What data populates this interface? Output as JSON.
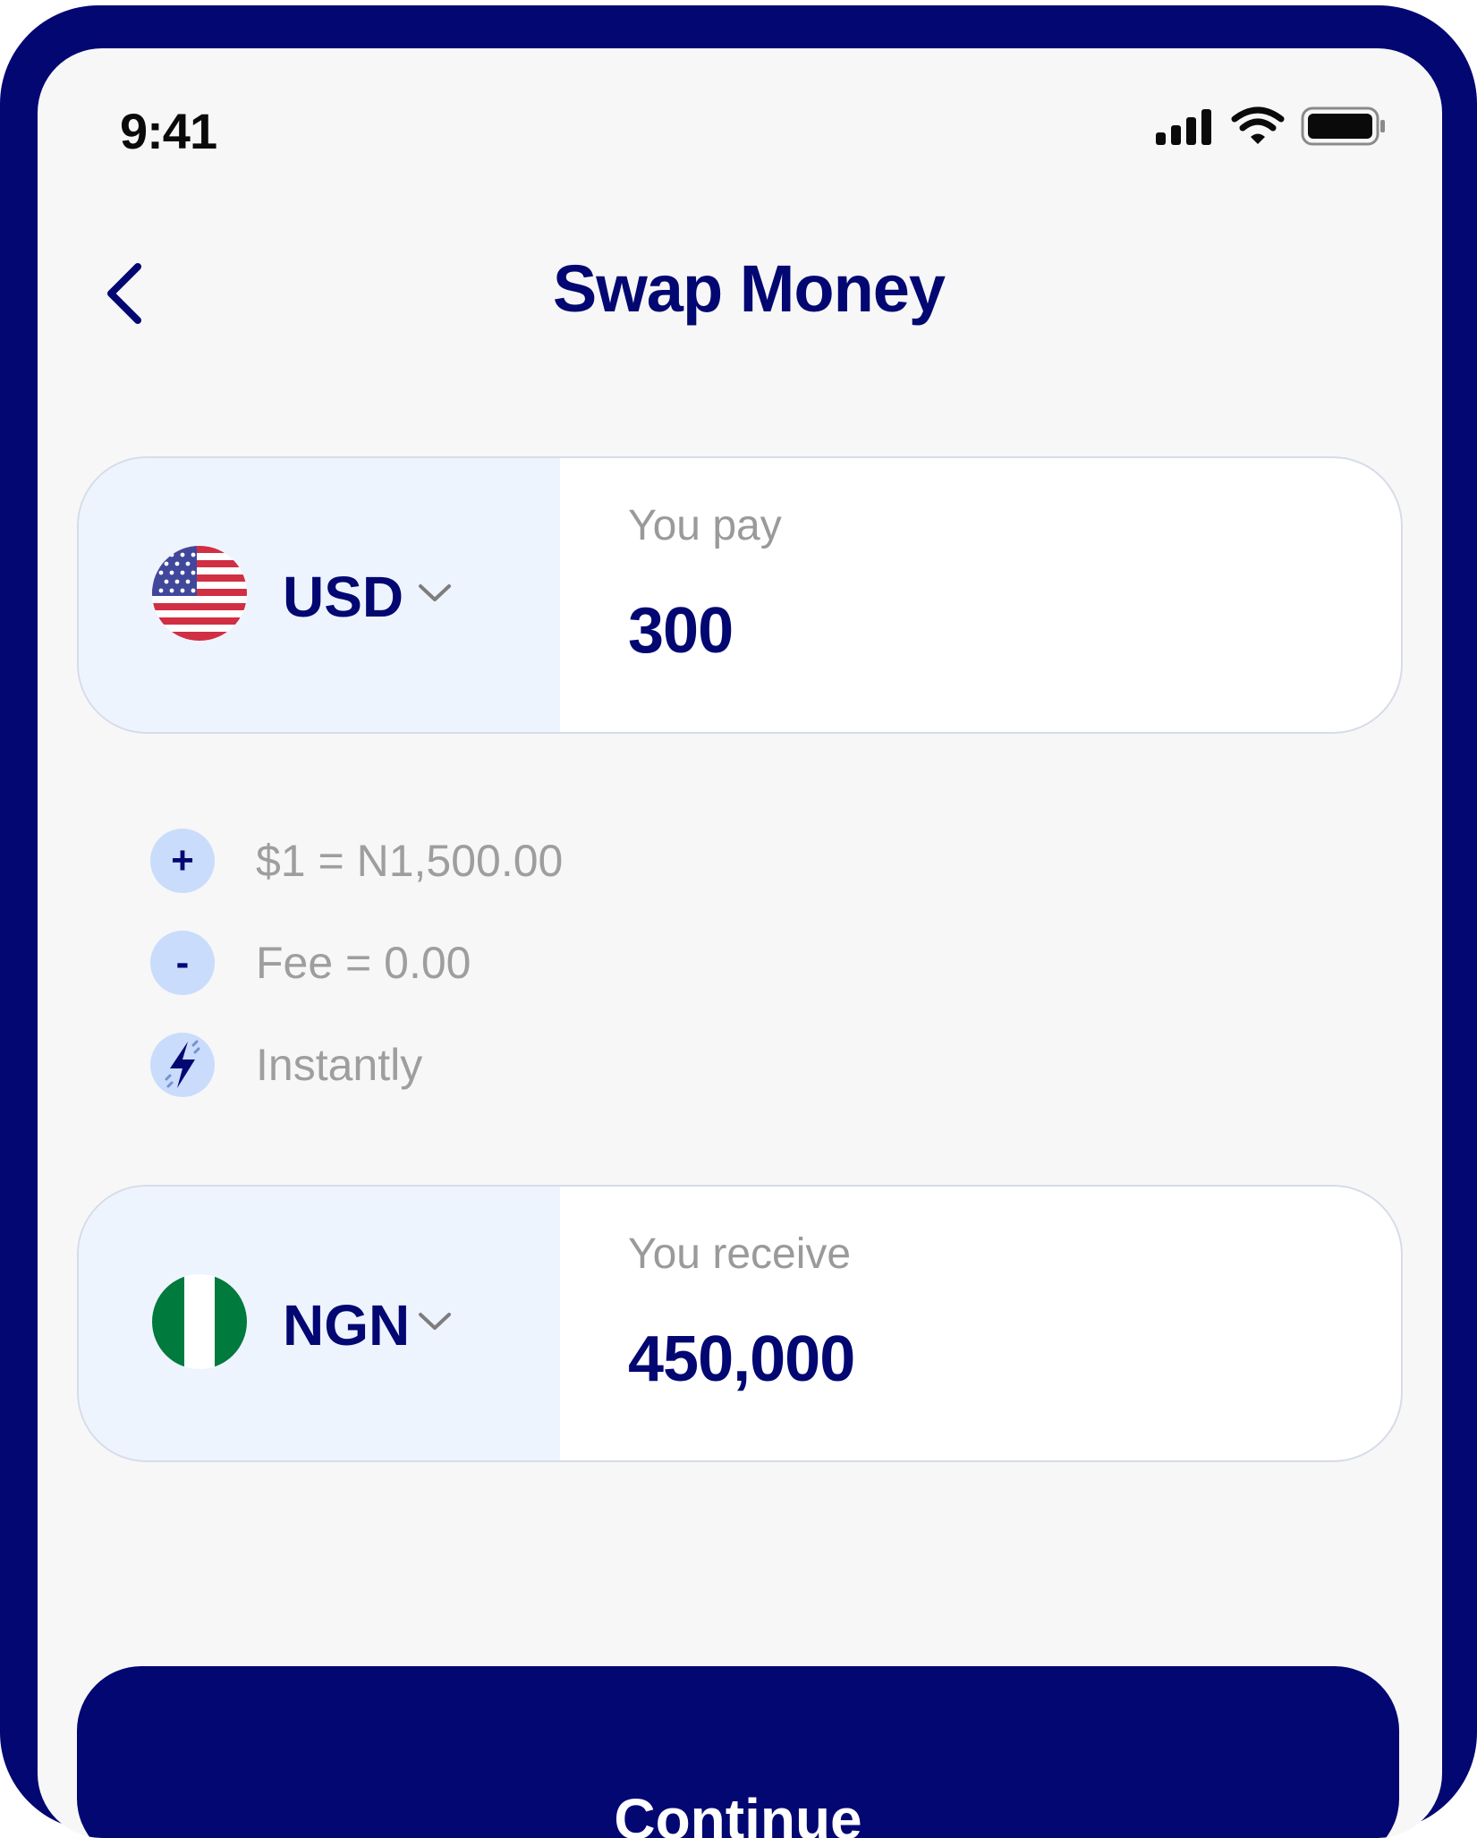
{
  "status_bar": {
    "time": "9:41",
    "icons": [
      "signal-icon",
      "wifi-icon",
      "battery-icon"
    ]
  },
  "header": {
    "back_icon": "chevron-left-icon",
    "title": "Swap Money"
  },
  "pay": {
    "currency": "USD",
    "flag": "us-flag-icon",
    "label": "You pay",
    "amount": "300"
  },
  "details": [
    {
      "icon": "plus-icon",
      "symbol": "+",
      "text": "$1 = N1,500.00"
    },
    {
      "icon": "minus-icon",
      "symbol": "-",
      "text": "Fee = 0.00"
    },
    {
      "icon": "lightning-icon",
      "symbol": "",
      "text": "Instantly"
    }
  ],
  "receive": {
    "currency": "NGN",
    "flag": "ng-flag-icon",
    "label": "You receive",
    "amount": "450,000"
  },
  "continue_button": {
    "label": "Continue"
  },
  "colors": {
    "primary": "#030772",
    "selector_bg": "#eef4fe",
    "icon_bg": "#c9dcfb",
    "muted": "#9e9e9e"
  }
}
